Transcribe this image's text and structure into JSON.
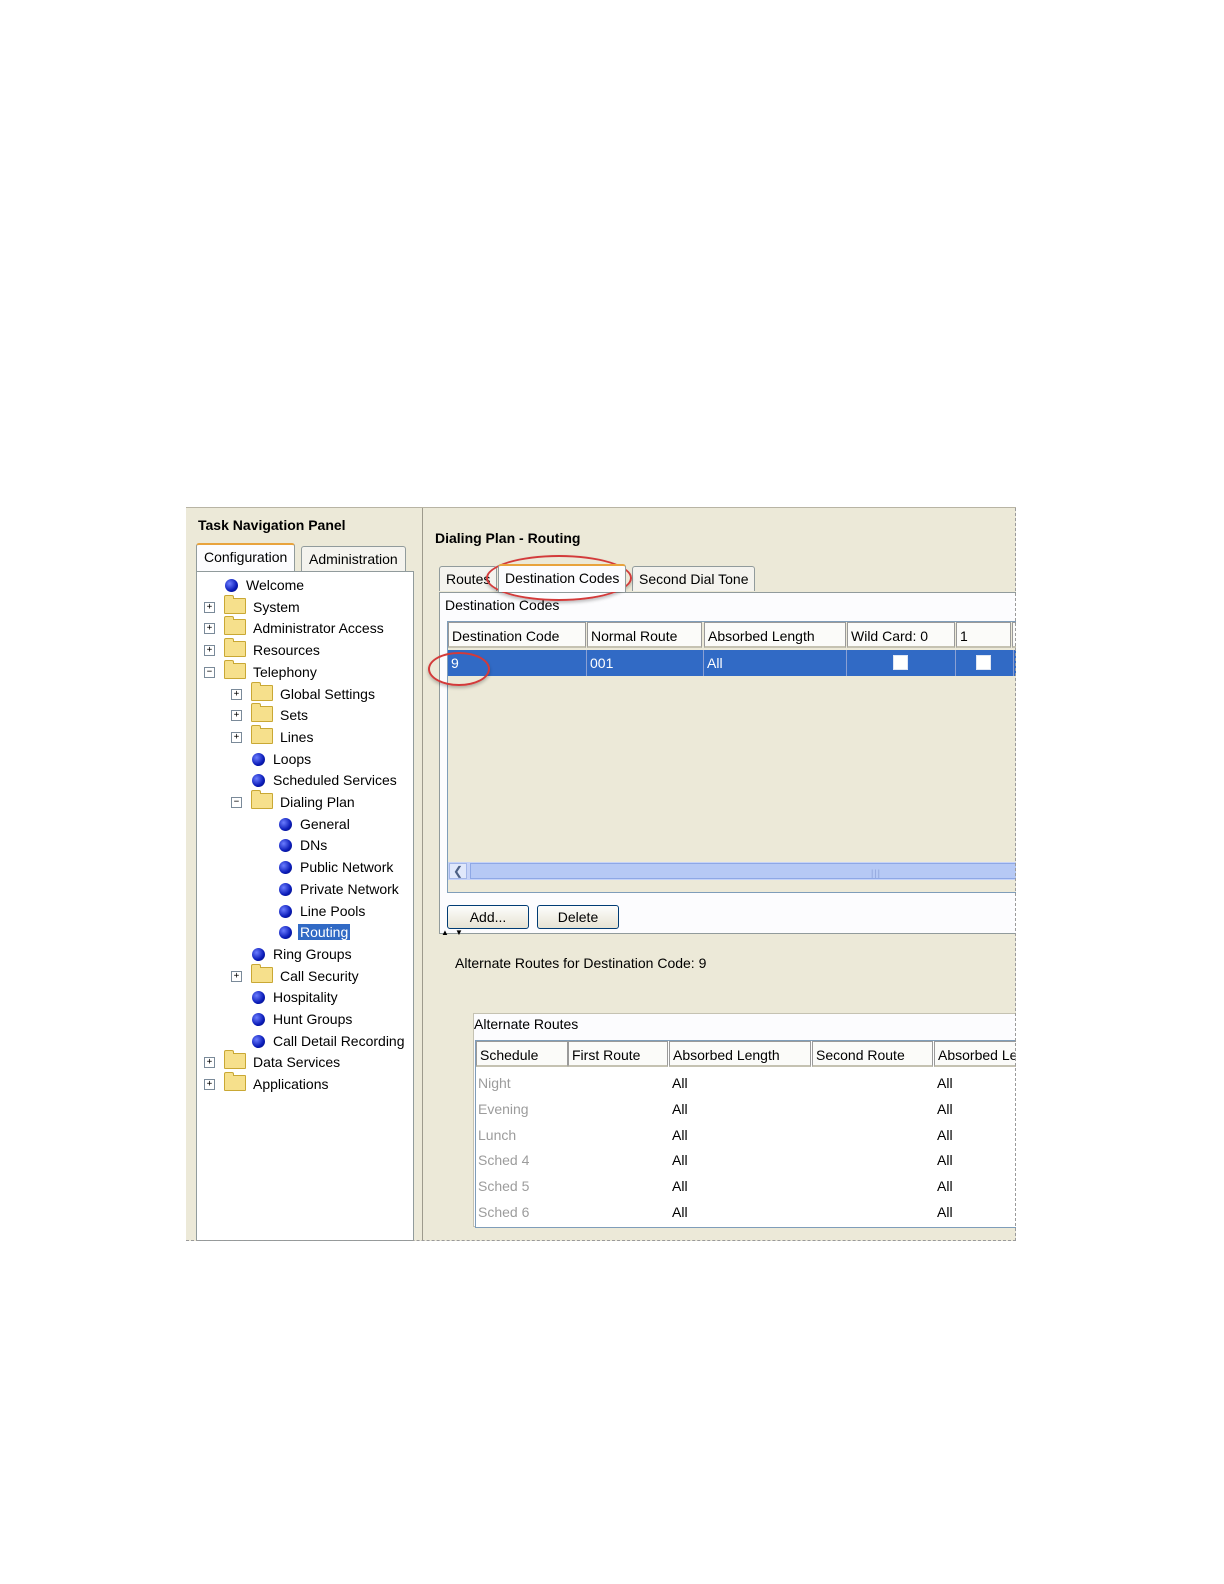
{
  "nav": {
    "title": "Task Navigation Panel",
    "tabs": [
      "Configuration",
      "Administration"
    ],
    "tree": [
      {
        "label": "Welcome",
        "icon": "bullet-icon",
        "level": 0,
        "expander": ""
      },
      {
        "label": "System",
        "icon": "folder-icon",
        "level": 0,
        "expander": "+"
      },
      {
        "label": "Administrator Access",
        "icon": "folder-icon",
        "level": 0,
        "expander": "+"
      },
      {
        "label": "Resources",
        "icon": "folder-icon",
        "level": 0,
        "expander": "+"
      },
      {
        "label": "Telephony",
        "icon": "folder-icon",
        "level": 0,
        "expander": "-"
      },
      {
        "label": "Global Settings",
        "icon": "folder-icon",
        "level": 1,
        "expander": "+"
      },
      {
        "label": "Sets",
        "icon": "folder-icon",
        "level": 1,
        "expander": "+"
      },
      {
        "label": "Lines",
        "icon": "folder-icon",
        "level": 1,
        "expander": "+"
      },
      {
        "label": "Loops",
        "icon": "bullet-icon",
        "level": 1,
        "expander": ""
      },
      {
        "label": "Scheduled Services",
        "icon": "bullet-icon",
        "level": 1,
        "expander": ""
      },
      {
        "label": "Dialing Plan",
        "icon": "folder-icon",
        "level": 1,
        "expander": "-"
      },
      {
        "label": "General",
        "icon": "bullet-icon",
        "level": 2,
        "expander": ""
      },
      {
        "label": "DNs",
        "icon": "bullet-icon",
        "level": 2,
        "expander": ""
      },
      {
        "label": "Public Network",
        "icon": "bullet-icon",
        "level": 2,
        "expander": ""
      },
      {
        "label": "Private Network",
        "icon": "bullet-icon",
        "level": 2,
        "expander": ""
      },
      {
        "label": "Line Pools",
        "icon": "bullet-icon",
        "level": 2,
        "expander": ""
      },
      {
        "label": "Routing",
        "icon": "bullet-icon",
        "level": 2,
        "expander": "",
        "selected": true
      },
      {
        "label": "Ring Groups",
        "icon": "bullet-icon",
        "level": 1,
        "expander": ""
      },
      {
        "label": "Call Security",
        "icon": "folder-icon",
        "level": 1,
        "expander": "+"
      },
      {
        "label": "Hospitality",
        "icon": "bullet-icon",
        "level": 1,
        "expander": ""
      },
      {
        "label": "Hunt Groups",
        "icon": "bullet-icon",
        "level": 1,
        "expander": ""
      },
      {
        "label": "Call Detail Recording",
        "icon": "bullet-icon",
        "level": 1,
        "expander": ""
      },
      {
        "label": "Data Services",
        "icon": "folder-icon",
        "level": 0,
        "expander": "+"
      },
      {
        "label": "Applications",
        "icon": "folder-icon",
        "level": 0,
        "expander": "+"
      }
    ]
  },
  "main": {
    "title": "Dialing Plan - Routing",
    "tabs": [
      "Routes",
      "Destination Codes",
      "Second Dial Tone"
    ],
    "active_tab": "Destination Codes",
    "group_label": "Destination Codes",
    "columns": [
      "Destination Code",
      "Normal Route",
      "Absorbed Length",
      "Wild Card: 0",
      "1"
    ],
    "rows": [
      {
        "destination_code": "9",
        "normal_route": "001",
        "absorbed_length": "All",
        "wild_card_0": false,
        "wild_card_1": false
      }
    ],
    "scroll_grip": "|||",
    "buttons": {
      "add": "Add...",
      "delete": "Delete"
    },
    "alternate": {
      "title": "Alternate Routes for Destination Code: 9",
      "group_label": "Alternate Routes",
      "columns": [
        "Schedule",
        "First Route",
        "Absorbed Length",
        "Second Route",
        "Absorbed Le"
      ],
      "rows": [
        {
          "schedule": "Night",
          "first_route": "",
          "absorbed_length": "All",
          "second_route": "",
          "absorbed_length_2": "All"
        },
        {
          "schedule": "Evening",
          "first_route": "",
          "absorbed_length": "All",
          "second_route": "",
          "absorbed_length_2": "All"
        },
        {
          "schedule": "Lunch",
          "first_route": "",
          "absorbed_length": "All",
          "second_route": "",
          "absorbed_length_2": "All"
        },
        {
          "schedule": "Sched 4",
          "first_route": "",
          "absorbed_length": "All",
          "second_route": "",
          "absorbed_length_2": "All"
        },
        {
          "schedule": "Sched 5",
          "first_route": "",
          "absorbed_length": "All",
          "second_route": "",
          "absorbed_length_2": "All"
        },
        {
          "schedule": "Sched 6",
          "first_route": "",
          "absorbed_length": "All",
          "second_route": "",
          "absorbed_length_2": "All"
        }
      ]
    }
  },
  "colors": {
    "selection": "#316ac5",
    "highlight_ellipse": "#d33a3a",
    "tab_accent": "#e8a33d"
  }
}
